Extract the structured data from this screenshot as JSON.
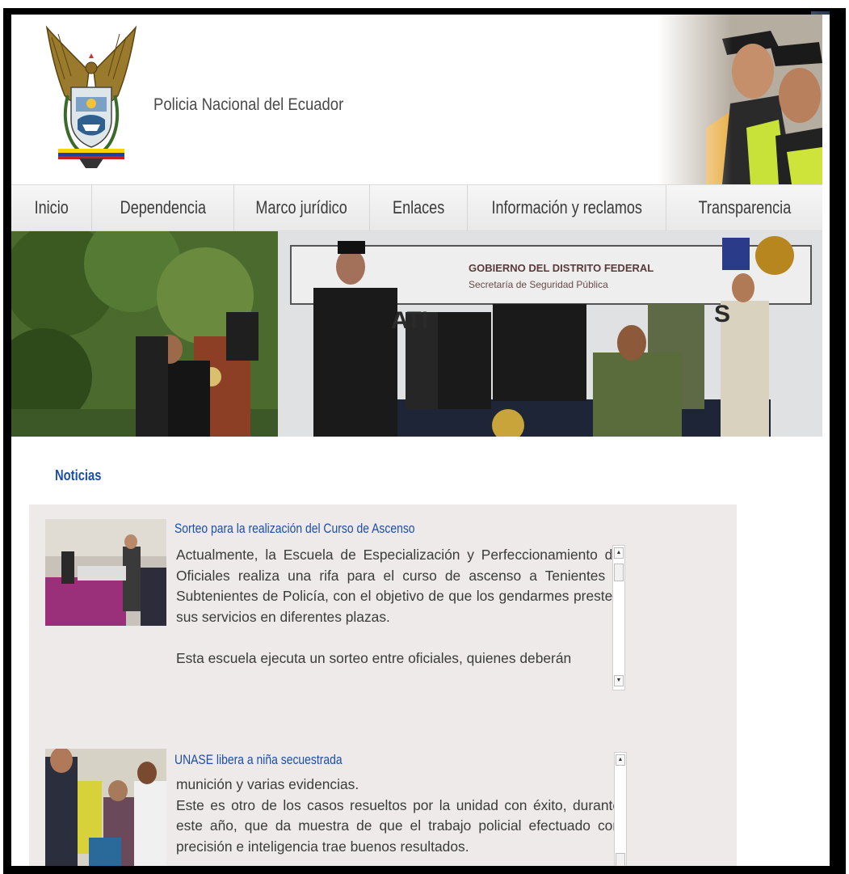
{
  "site": {
    "title": "Policia Nacional del Ecuador"
  },
  "nav": {
    "items": [
      {
        "label": "Inicio"
      },
      {
        "label": "Dependencia"
      },
      {
        "label": "Marco jurídico"
      },
      {
        "label": "Enlaces"
      },
      {
        "label": "Información y reclamos"
      },
      {
        "label": "Transparencia"
      }
    ]
  },
  "banner": {
    "sign_line1": "GOBIERNO DEL DISTRITO FEDERAL",
    "sign_line2": "Secretaría de Seguridad Pública"
  },
  "news": {
    "section_title": "Noticias",
    "items": [
      {
        "title": "Sorteo para la realización del Curso de Ascenso",
        "paragraphs": [
          "Actualmente, la Escuela de Especialización  y Perfeccionamiento de Oficiales realiza una rifa para el curso de ascenso a Tenientes y Subtenientes de Policía, con el objetivo de que los gendarmes presten sus servicios en diferentes plazas.",
          "Esta escuela ejecuta un sorteo entre oficiales, quienes deberán"
        ]
      },
      {
        "title": "UNASE libera a niña secuestrada",
        "paragraphs": [
          "munición y varias evidencias.",
          "Este es otro de los casos resueltos por la unidad con éxito, durante este año, que da muestra de que el trabajo policial efectuado con precisión e inteligencia  trae buenos resultados."
        ]
      }
    ]
  },
  "colors": {
    "link_blue": "#1c4fa5",
    "panel_bg": "#eeeaea",
    "frame": "#000000"
  },
  "icons": {
    "scroll_up": "scroll-up-arrow-icon",
    "scroll_down": "scroll-down-arrow-icon",
    "crest": "police-crest-icon"
  }
}
